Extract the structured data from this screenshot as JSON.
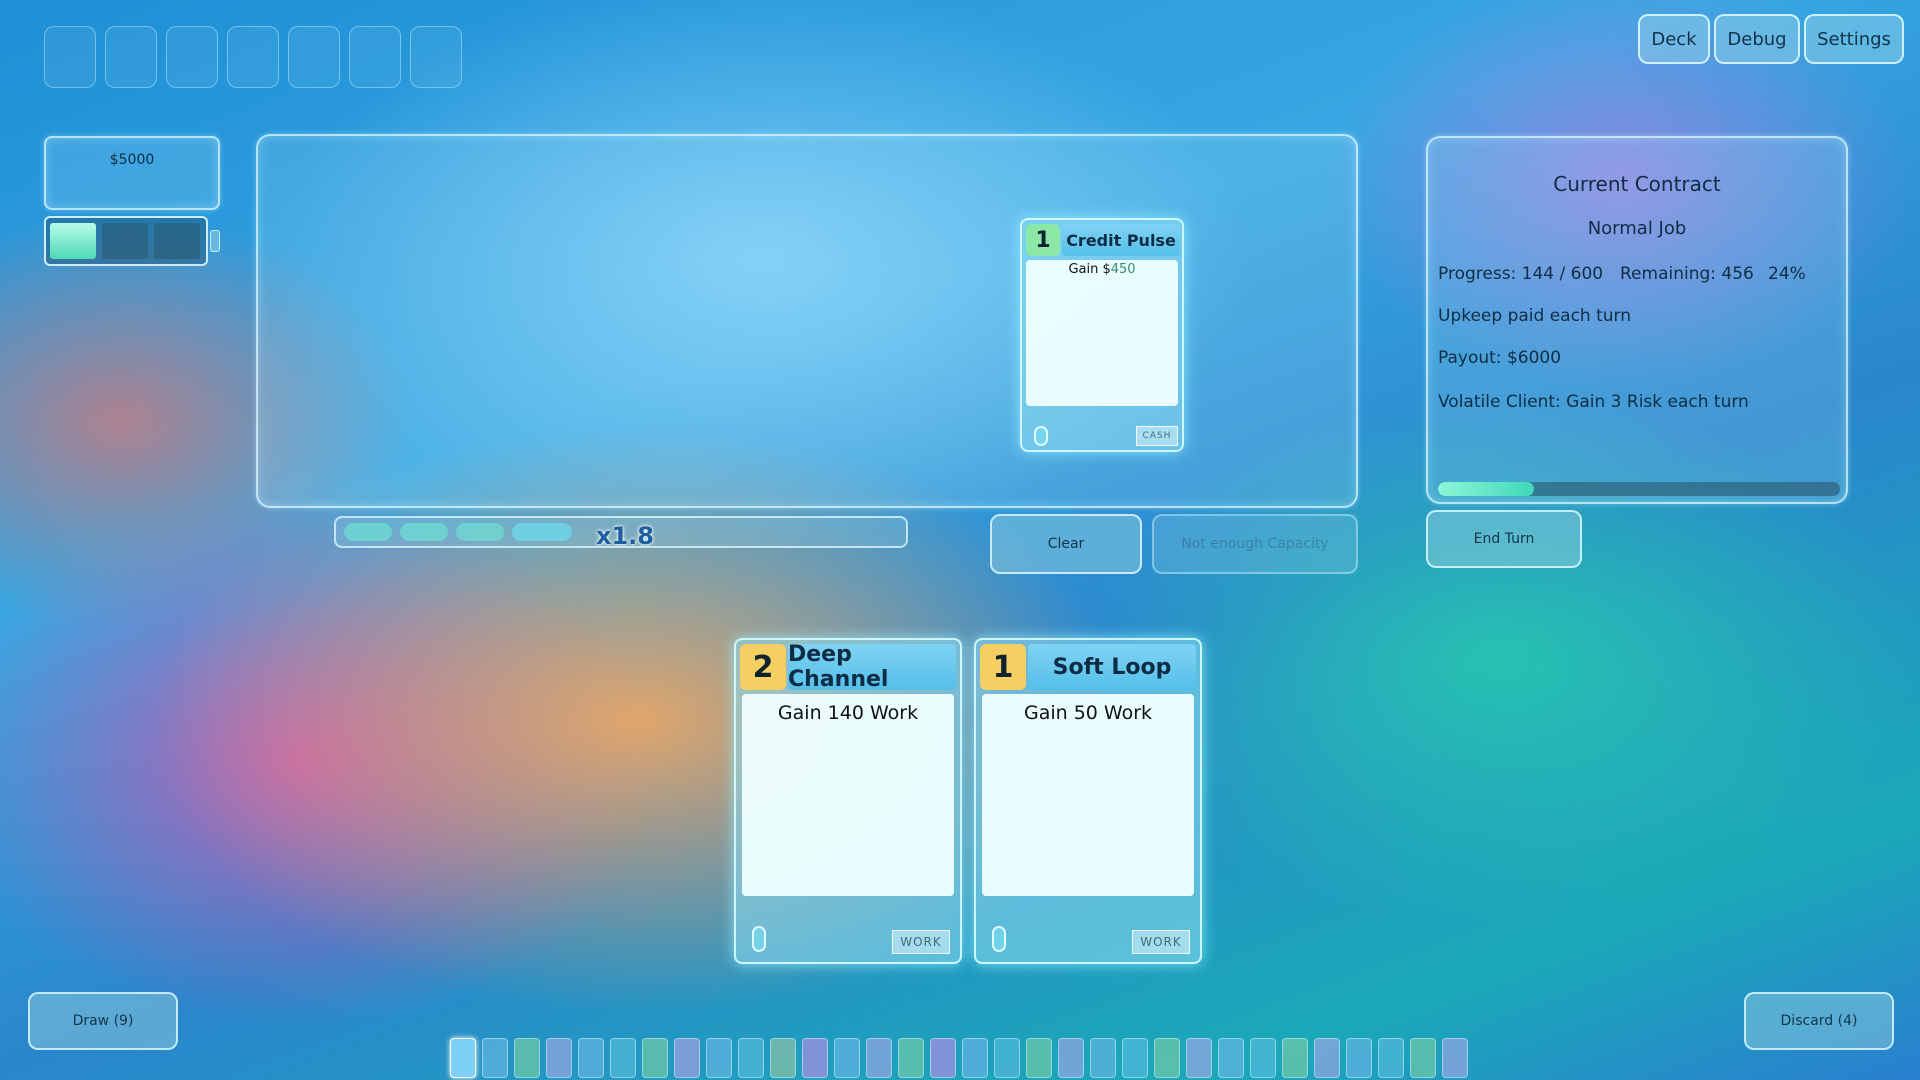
{
  "top_slots": 7,
  "money": "$5000",
  "energy": {
    "filled": 1,
    "total": 3
  },
  "menu": {
    "deck": "Deck",
    "debug": "Debug",
    "settings": "Settings"
  },
  "play_area": {
    "card": {
      "cost": "1",
      "title": "Credit Pulse",
      "text_prefix": "Gain $",
      "text_value": "450",
      "tag": "CASH"
    }
  },
  "multiplier": {
    "segments_filled": 4,
    "label": "x1.8"
  },
  "actions": {
    "clear": "Clear",
    "play_status": "Not enough Capacity",
    "end_turn": "End Turn"
  },
  "contract": {
    "title": "Current Contract",
    "job": "Normal Job",
    "progress": "Progress: 144 / 600",
    "remaining": "Remaining: 456",
    "percent_text": "24%",
    "percent": 24,
    "upkeep": "Upkeep paid each turn",
    "payout": "Payout: $6000",
    "modifier": "Volatile Client: Gain 3 Risk each turn"
  },
  "hand": [
    {
      "cost": "2",
      "title": "Deep Channel",
      "text": "Gain 140 Work",
      "tag": "WORK"
    },
    {
      "cost": "1",
      "title": "Soft Loop",
      "text": "Gain 50 Work",
      "tag": "WORK"
    }
  ],
  "draw_pile": "Draw (9)",
  "discard_pile": "Discard (4)",
  "deck_strip": {
    "colors": [
      "#7fd0f5",
      "#5fb3e0",
      "#6cc7a8",
      "#8fa6e0",
      "#5fb3e0",
      "#4fb8d8",
      "#6cc7a8",
      "#9aa0e0",
      "#5fb3e0",
      "#4fb8d8",
      "#86c0a8",
      "#a38fe0",
      "#5fb3e0",
      "#8fa6e0",
      "#6cc7a8",
      "#a38fe0",
      "#5fb3e0",
      "#4fb8d8",
      "#6cc7a8",
      "#8fa6e0",
      "#5fb3e0",
      "#4fb8d8",
      "#6cc7a8",
      "#8fa6e0",
      "#5fb3e0",
      "#4fb8d8",
      "#6cc7a8",
      "#8fa6e0",
      "#5fb3e0",
      "#4fb8d8",
      "#6cc7a8",
      "#8fa6e0"
    ]
  }
}
